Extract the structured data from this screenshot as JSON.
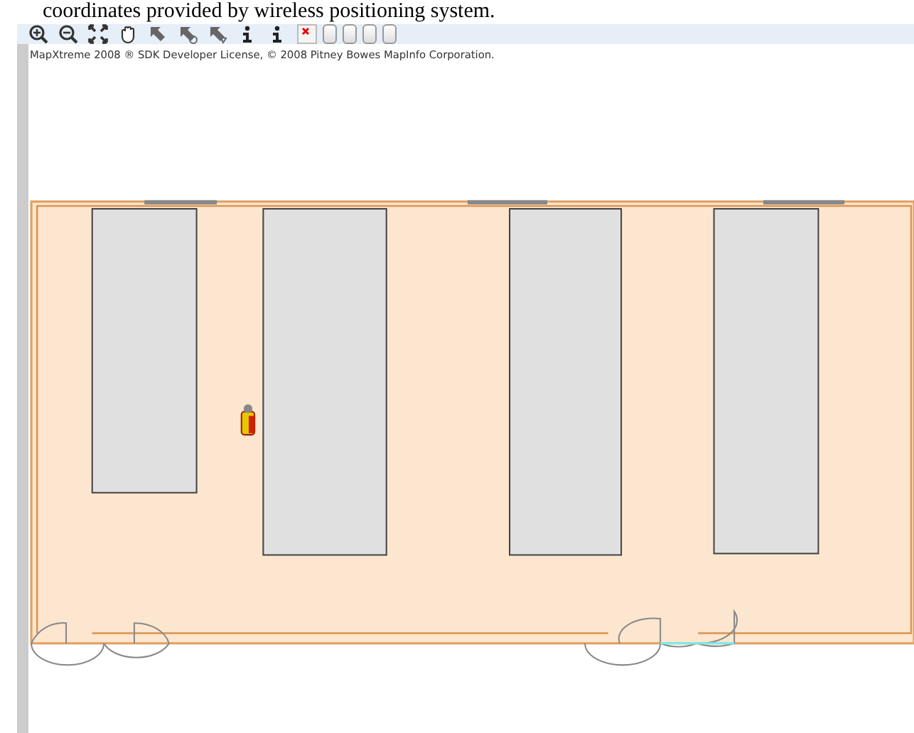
{
  "caption": "coordinates provided by wireless positioning system.",
  "toolbar": [
    {
      "kind": "zoom-in"
    },
    {
      "kind": "zoom-out"
    },
    {
      "kind": "full-extent"
    },
    {
      "kind": "pan"
    },
    {
      "kind": "select"
    },
    {
      "kind": "select-radius"
    },
    {
      "kind": "select-polygon"
    },
    {
      "kind": "info"
    },
    {
      "kind": "info"
    },
    {
      "kind": "broken-image"
    },
    {
      "kind": "blank"
    },
    {
      "kind": "blank"
    },
    {
      "kind": "blank"
    },
    {
      "kind": "blank"
    }
  ],
  "map": {
    "copyright": "MapXtreme 2008 ® SDK Developer License, © 2008 Pitney Bowes MapInfo Corporation."
  }
}
